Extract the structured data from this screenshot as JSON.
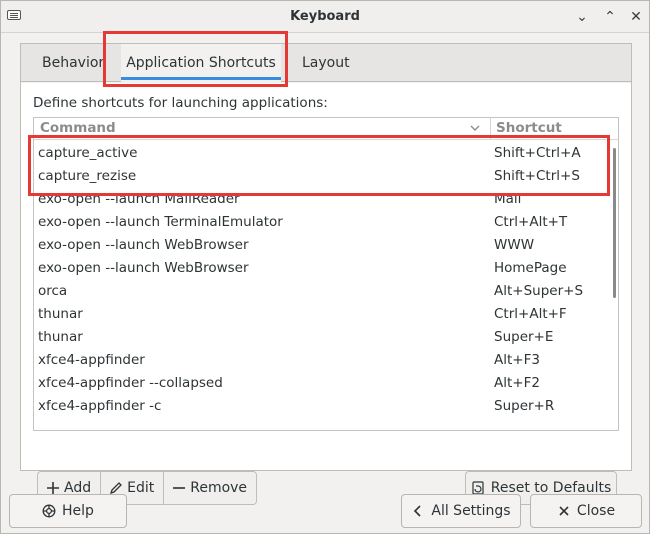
{
  "window": {
    "title": "Keyboard",
    "titlebar_buttons": [
      "minimize-icon",
      "maximize-icon",
      "close-icon"
    ]
  },
  "tabs": [
    {
      "label": "Behavior",
      "active": false
    },
    {
      "label": "Application Shortcuts",
      "active": true
    },
    {
      "label": "Layout",
      "active": false
    }
  ],
  "page": {
    "description": "Define shortcuts for launching applications:",
    "columns": {
      "command": "Command",
      "shortcut": "Shortcut"
    },
    "rows": [
      {
        "command": "capture_active",
        "shortcut": "Shift+Ctrl+A"
      },
      {
        "command": "capture_rezise",
        "shortcut": "Shift+Ctrl+S"
      },
      {
        "command": "exo-open --launch MailReader",
        "shortcut": "Mail"
      },
      {
        "command": "exo-open --launch TerminalEmulator",
        "shortcut": "Ctrl+Alt+T"
      },
      {
        "command": "exo-open --launch WebBrowser",
        "shortcut": "WWW"
      },
      {
        "command": "exo-open --launch WebBrowser",
        "shortcut": "HomePage"
      },
      {
        "command": "orca",
        "shortcut": "Alt+Super+S"
      },
      {
        "command": "thunar",
        "shortcut": "Ctrl+Alt+F"
      },
      {
        "command": "thunar",
        "shortcut": "Super+E"
      },
      {
        "command": "xfce4-appfinder",
        "shortcut": "Alt+F3"
      },
      {
        "command": "xfce4-appfinder --collapsed",
        "shortcut": "Alt+F2"
      },
      {
        "command": "xfce4-appfinder -c",
        "shortcut": "Super+R"
      }
    ],
    "toolbar": {
      "add": "Add",
      "edit": "Edit",
      "remove": "Remove",
      "reset": "Reset to Defaults"
    }
  },
  "bottom": {
    "help": "Help",
    "all_settings": "All Settings",
    "close": "Close"
  },
  "colors": {
    "accent": "#3a8dde",
    "highlight": "#e53935"
  }
}
